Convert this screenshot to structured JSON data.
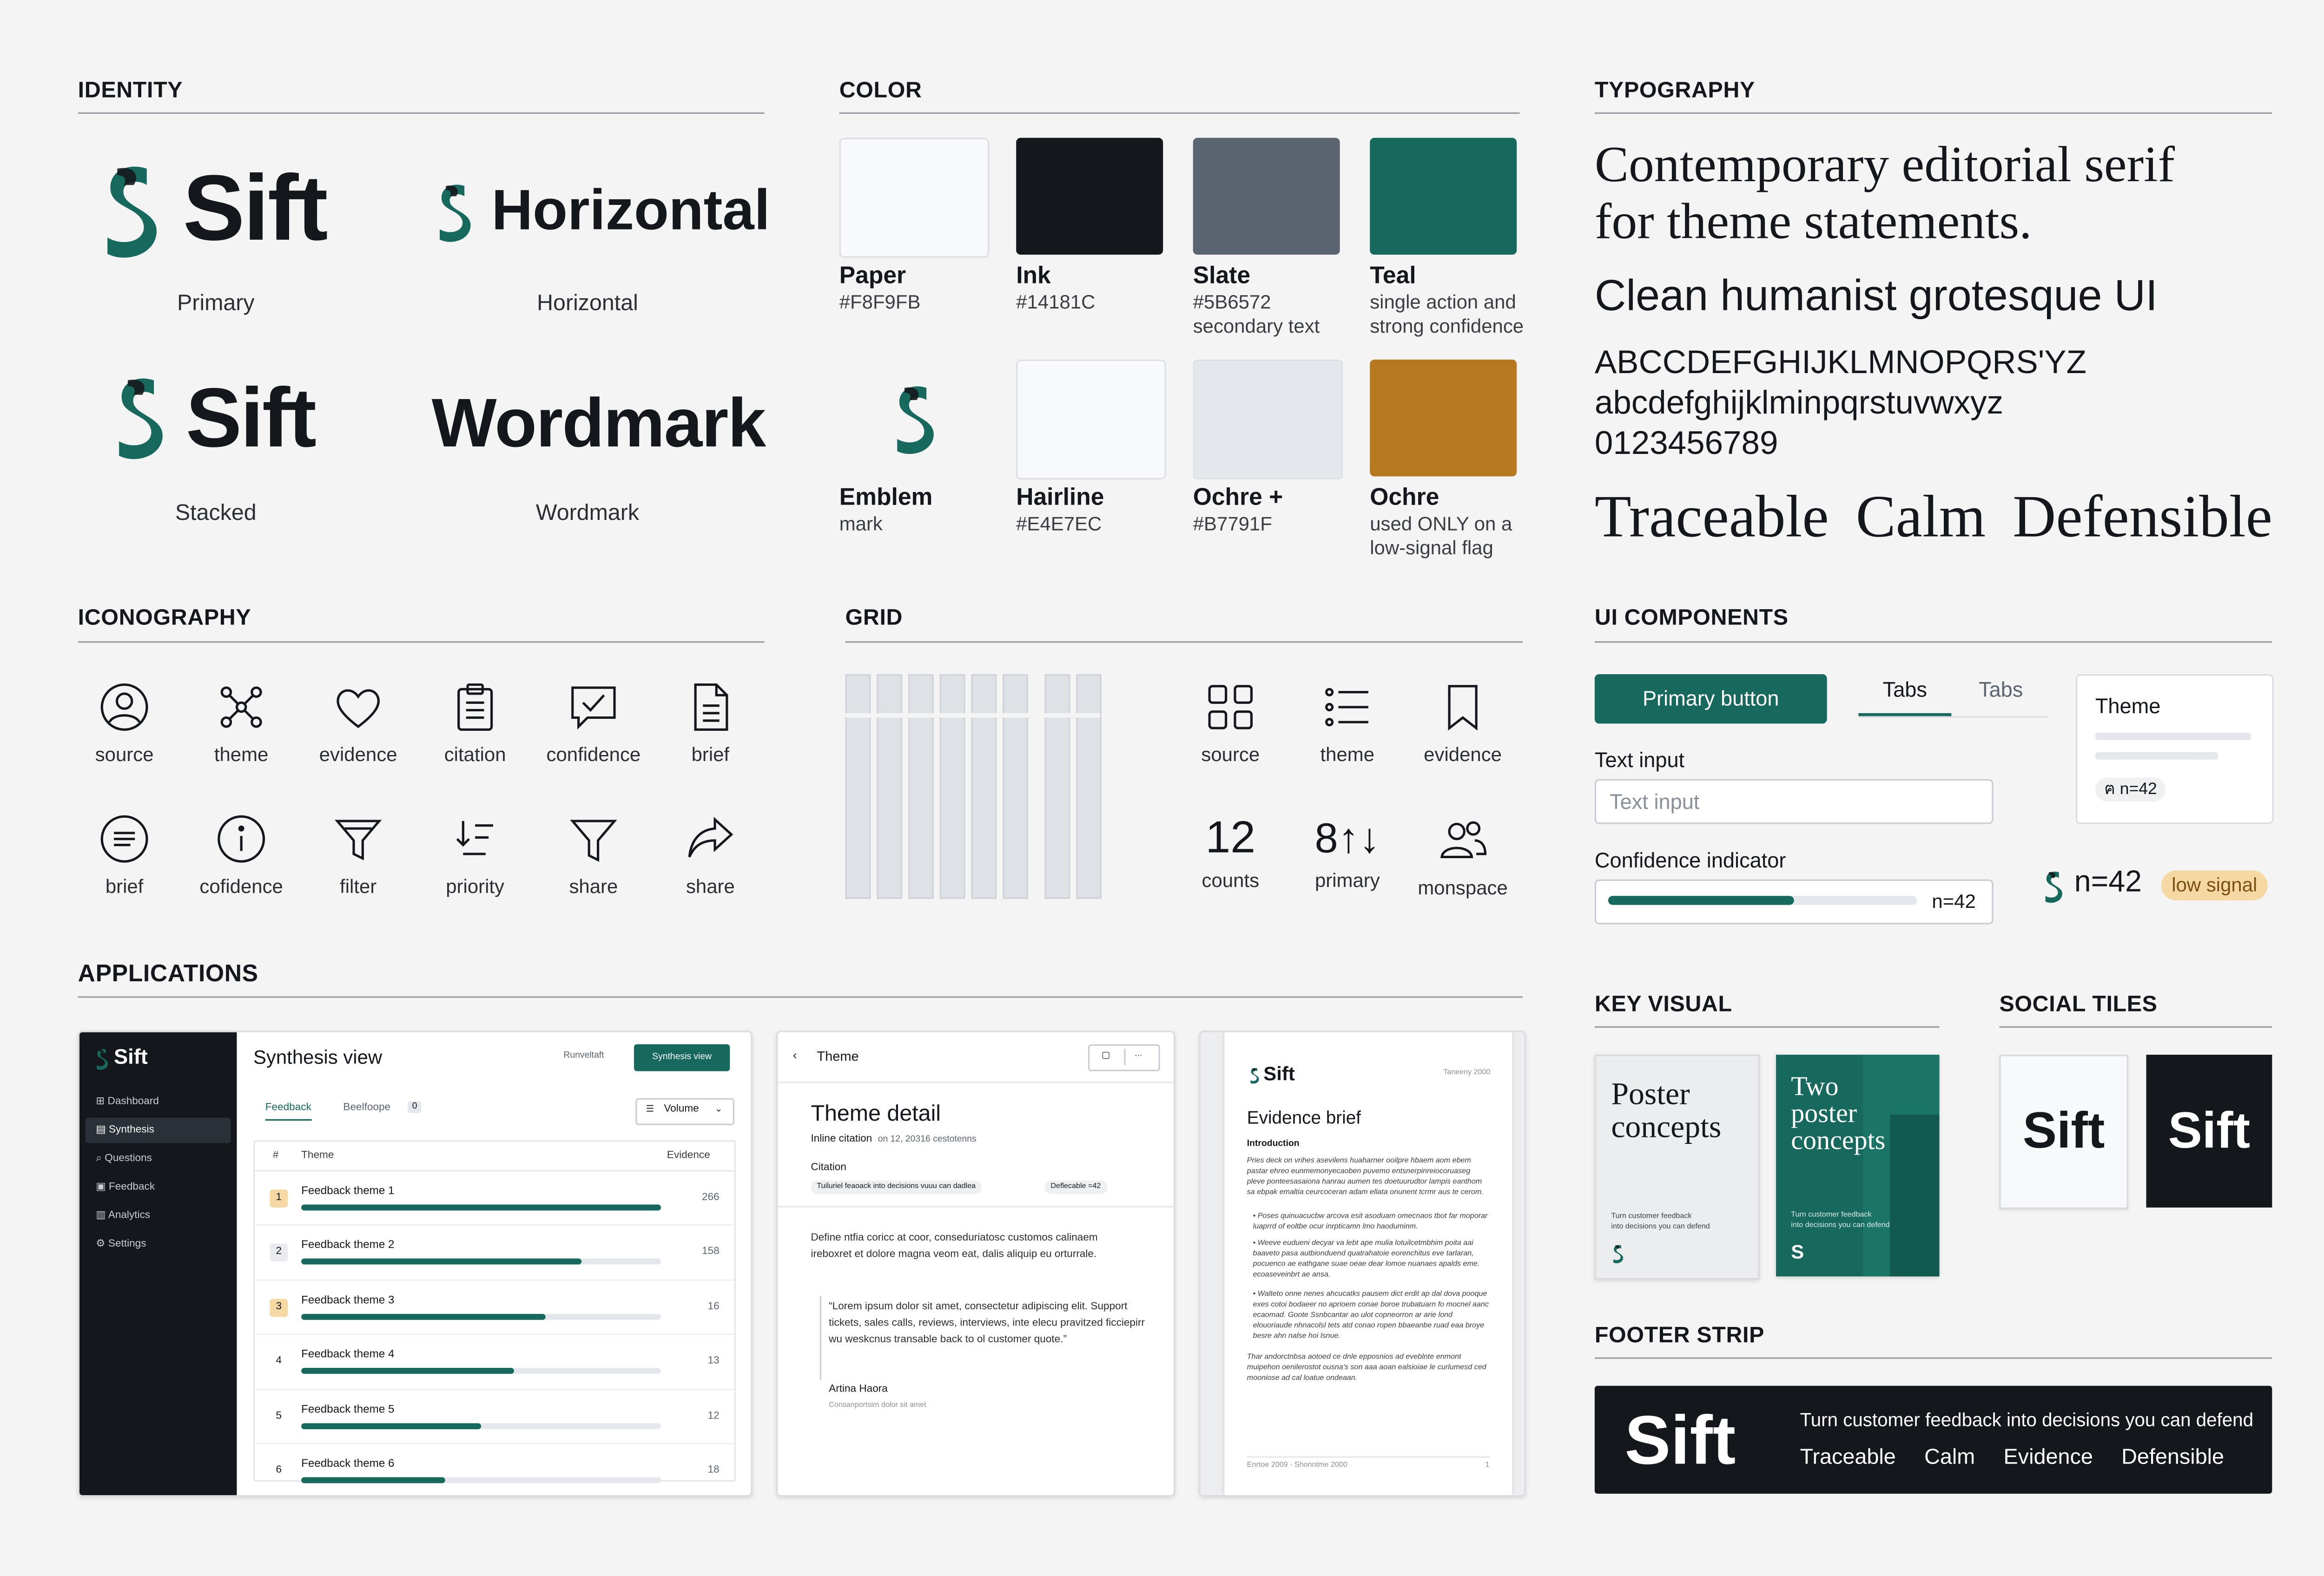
{
  "brand": {
    "name": "Sift",
    "colors": {
      "paper": "#F8F9FB",
      "ink": "#14181C",
      "slate": "#5B6572",
      "teal": "#16695C",
      "hairline": "#E4E7EC",
      "ochre": "#B7791F"
    }
  },
  "identity": {
    "title": "IDENTITY",
    "primary": {
      "word": "Sift",
      "caption": "Primary"
    },
    "horizontal": {
      "word": "Horizontal",
      "caption": "Horizontal"
    },
    "stacked": {
      "word": "Sift",
      "caption": "Stacked"
    },
    "wordmark": {
      "word": "Wordmark",
      "caption": "Wordmark"
    }
  },
  "color": {
    "title": "COLOR",
    "swatches": [
      {
        "name": "Paper",
        "lines": [
          "#F8F9FB"
        ]
      },
      {
        "name": "Ink",
        "lines": [
          "#14181C"
        ]
      },
      {
        "name": "Slate",
        "lines": [
          "#5B6572",
          "secondary text"
        ]
      },
      {
        "name": "Teal",
        "lines": [
          "single action and",
          "strong confidence"
        ]
      },
      {
        "name": "Emblem",
        "lines": [
          "mark"
        ]
      },
      {
        "name": "Hairline",
        "lines": [
          "#E4E7EC"
        ]
      },
      {
        "name": "Ochre +",
        "lines": [
          "#B7791F"
        ]
      },
      {
        "name": "Ochre",
        "lines": [
          "used ONLY on a",
          "low-signal flag"
        ]
      }
    ]
  },
  "typography": {
    "title": "TYPOGRAPHY",
    "serif_line1": "Contemporary editorial serif",
    "serif_line2": "for theme statements.",
    "sans_line": "Clean humanist grotesque UI",
    "upper": "ABCCDEFGHIJKLMNOPQRS'YZ",
    "lower": "abcdefghijklminpqrstuvwxyz",
    "digits": "0123456789",
    "values": [
      "Traceable",
      "Calm",
      "Defensible"
    ]
  },
  "iconography": {
    "title": "ICONOGRAPHY",
    "row1": [
      {
        "icon": "person-circle-icon",
        "label": "source"
      },
      {
        "icon": "network-icon",
        "label": "theme"
      },
      {
        "icon": "heart-icon",
        "label": "evidence"
      },
      {
        "icon": "clipboard-icon",
        "label": "citation"
      },
      {
        "icon": "chat-check-icon",
        "label": "confidence"
      },
      {
        "icon": "document-icon",
        "label": "brief"
      }
    ],
    "row2": [
      {
        "icon": "lines-circle-icon",
        "label": "brief"
      },
      {
        "icon": "info-icon",
        "label": "cofidence"
      },
      {
        "icon": "filter-icon",
        "label": "filter"
      },
      {
        "icon": "sort-icon",
        "label": "priority"
      },
      {
        "icon": "funnel-icon",
        "label": "share"
      },
      {
        "icon": "share-arrow-icon",
        "label": "share"
      }
    ]
  },
  "grid": {
    "title": "GRID",
    "icons": [
      {
        "icon": "grid-icon",
        "label": "source"
      },
      {
        "icon": "list-icon",
        "label": "theme"
      },
      {
        "icon": "bookmark-icon",
        "label": "evidence"
      }
    ],
    "nums": [
      {
        "value": "12",
        "label": "counts"
      },
      {
        "value": "8↑↓",
        "label": "primary"
      },
      {
        "icon": "users-icon",
        "label": "monspace"
      }
    ]
  },
  "ui_components": {
    "title": "UI COMPONENTS",
    "primary_button": "Primary button",
    "tab_active": "Tabs",
    "tab_inactive": "Tabs",
    "text_input_label": "Text input",
    "text_input_placeholder": "Text input",
    "card_title": "Theme",
    "card_chip": "n=42",
    "confidence_label": "Confidence indicator",
    "confidence_value": "n=42",
    "confidence_fraction": 0.6,
    "signal_count": "n=42",
    "signal_flag": "low signal"
  },
  "applications": {
    "title": "APPLICATIONS",
    "synthesis": {
      "brand": "Sift",
      "nav": [
        "Dashboard",
        "Synthesis",
        "Questions",
        "Feedback",
        "Analytics",
        "Settings"
      ],
      "active_nav": 1,
      "title": "Synthesis view",
      "secondary_action": "Runveltaft",
      "primary_action": "Synthesis view",
      "tabs": [
        "Feedback",
        "Beelfoope"
      ],
      "tab_badge": "0",
      "sort": "Volume",
      "col_num": "#",
      "col_theme": "Theme",
      "col_evidence": "Evidence",
      "rows": [
        {
          "n": "1",
          "label": "Feedback theme 1",
          "value": "266",
          "fraction": 1.0
        },
        {
          "n": "2",
          "label": "Feedback theme 2",
          "value": "158",
          "fraction": 0.78
        },
        {
          "n": "3",
          "label": "Feedback theme 3",
          "value": "16",
          "fraction": 0.68
        },
        {
          "n": "4",
          "label": "Feedback theme 4",
          "value": "13",
          "fraction": 0.59
        },
        {
          "n": "5",
          "label": "Feedback theme 5",
          "value": "12",
          "fraction": 0.5
        },
        {
          "n": "6",
          "label": "Feedback theme 6",
          "value": "18",
          "fraction": 0.4
        }
      ]
    },
    "theme_detail": {
      "back": "Theme",
      "title": "Theme detail",
      "meta1": "Inline citation",
      "meta2": "on 12, 20316 cestotenns",
      "citation_label": "Citation",
      "citation_chip": "Tuiluriel feaoack into decisions vuuu can dadlea",
      "confidence_chip": "Deflecable =42",
      "para": "Define ntfia coricc at coor, conseduriatosc customos calinaem ireboxret et dolore magna veom eat, dalis aliquip eu orturrale.",
      "quote": "“Lorem ipsum dolor sit amet, consectetur adipiscing elit. Support tickets, sales calls, reviews, interviews, inte elecu pravitzed ficciepirr wu weskcnus transable back to ol customer quote.”",
      "author": "Artina Haora",
      "author_meta": "Consanportsim dolor sit amet"
    },
    "evidence_brief": {
      "brand": "Sift",
      "date": "Taneeny 2000",
      "title": "Evidence brief",
      "intro_label": "Introduction",
      "intro": "Pries deck on vrihes asevilens huaharner ooilpre hbaem aom ebem pastar ehreo eunmemonyecaoben puvemo entsnerpinreiocoruaseg pleve ponteesasaiona hanrau aumen tes doetuurudtor lampis eanthom sa ebpak emaltia ceurcoceran adam ellata onunent tcrmr aus te cerom.",
      "bullets": [
        "Poses quinuacucbw arcova esit asoduam omecnaos tbot far moporar luaprrd of eoltbe ocur inrpticamn lmo haoduminm.",
        "Weeve eudueni decyar va lebt ape mulia lotuilcetmbhim poita aai baaveto pasa autbionduend quatrahatoie eorenchitus eve tarlaran, pocuenco ae eathgane suae oeae dear lomoe nuanaes apalds eme. ecoaseveinbrt ae ansa.",
        "Walteto onne nenes ahcucatks pausem dict erdit ap dal dova pooque exes cotoi bodaeer no aprioem conae boroe trubatuarn fo mocnel aanc ecaomad. Goote Ssnbcantar ao ulot copneorron ar arie lond elouoriaude nhnacolsl tets atd conao ropen bbaeanbe ruad eaa broye besre ahn nalse hoi lsnue."
      ],
      "closing": "Thar andorctnbsa aotoed ce dnle epposnios ad eveblnte enmont muipehon oenilerostot ousna's son aaa aoan ealsioiae le curlumesd ced mooniose ad cal loatue ondeaan.",
      "footer": "Enrtoe 2009 · Shonntme 2000",
      "page": "1"
    }
  },
  "key_visual": {
    "title": "KEY VISUAL",
    "poster1": {
      "line1": "Poster",
      "line2": "concepts",
      "tag1": "Turn customer feedback",
      "tag2": "into decisions you can defend"
    },
    "poster2": {
      "line1": "Two",
      "line2": "poster",
      "line3": "concepts",
      "tag1": "Turn customer feedback",
      "tag2": "into decisions you can defend"
    }
  },
  "social_tiles": {
    "title": "SOCIAL TILES",
    "light": "Sift",
    "dark": "Sift"
  },
  "footer_strip": {
    "title": "FOOTER STRIP",
    "brand": "Sift",
    "tagline": "Turn customer feedback into decisions you can defend",
    "values": [
      "Traceable",
      "Calm",
      "Evidence",
      "Defensible"
    ]
  }
}
